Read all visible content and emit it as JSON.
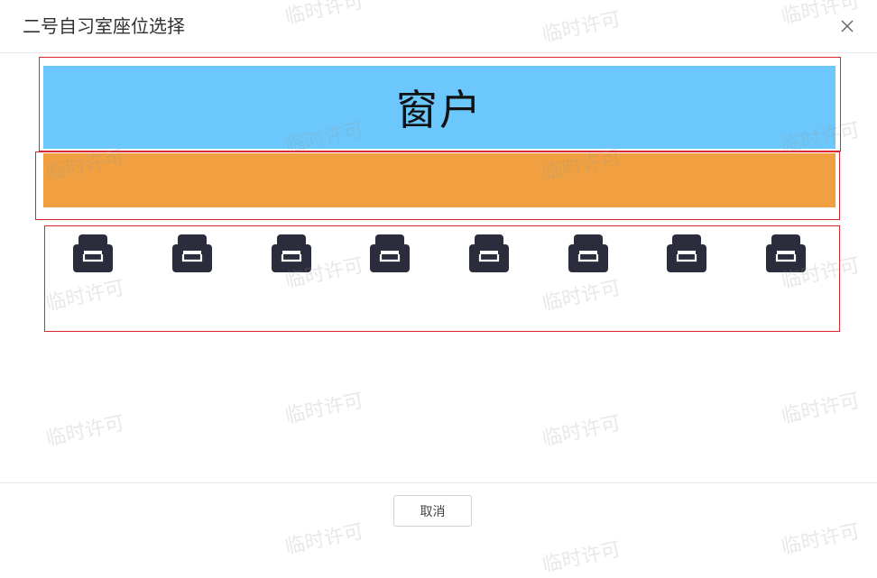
{
  "dialog": {
    "title": "二号自习室座位选择",
    "close_icon": "close-icon"
  },
  "room": {
    "window_label": "窗户",
    "window_color": "#6cc8fc",
    "aisle_color": "#f0a040",
    "outline_color": "#d9282f"
  },
  "seats": {
    "icon": "armchair-icon",
    "color": "#2b2c3c",
    "count": 8
  },
  "footer": {
    "cancel_label": "取消"
  },
  "watermark": {
    "text": "临时许可"
  }
}
